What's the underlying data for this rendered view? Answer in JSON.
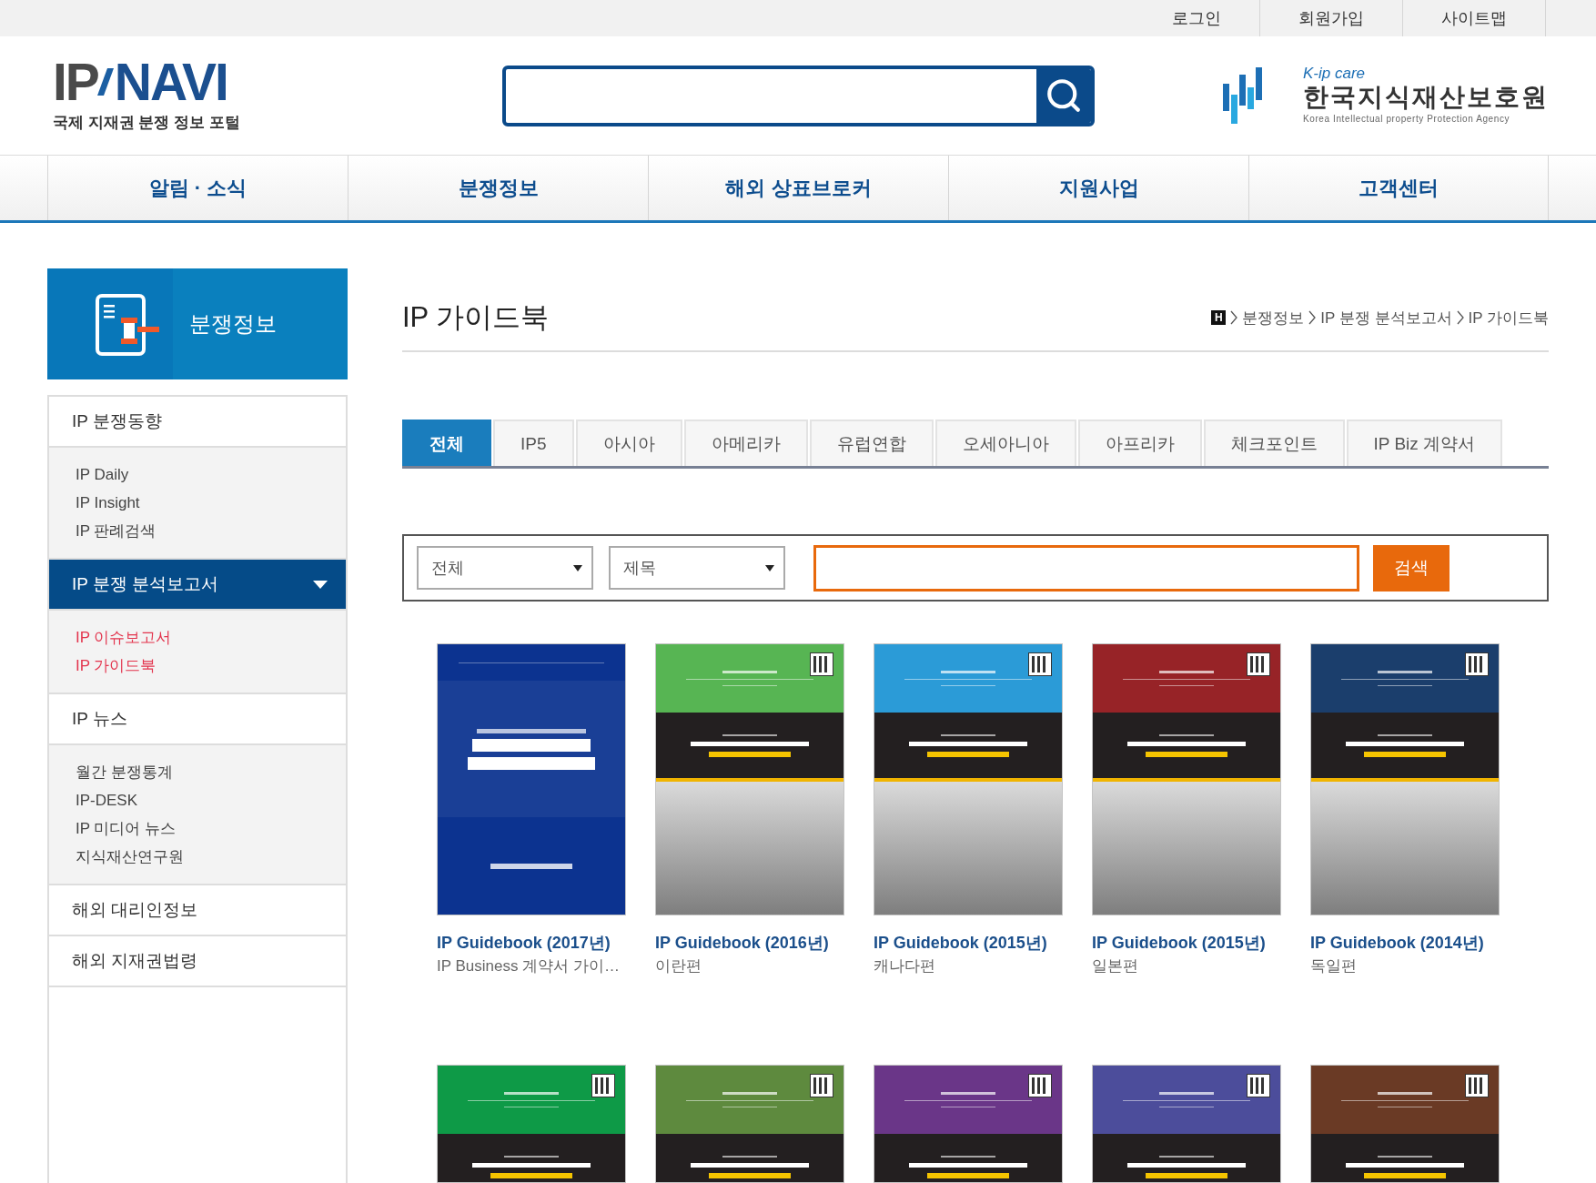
{
  "top_links": [
    "로그인",
    "회원가입",
    "사이트맵"
  ],
  "logo": {
    "left": "IP",
    "right": "NAVI",
    "tagline": "국제 지재권 분쟁 정보 포털"
  },
  "agency": {
    "brand": "K-ip care",
    "name": "한국지식재산보호원",
    "english": "Korea Intellectual property Protection Agency"
  },
  "nav": [
    "알림 · 소식",
    "분쟁정보",
    "해외 상표브로커",
    "지원사업",
    "고객센터"
  ],
  "sidebar": {
    "title": "분쟁정보",
    "sections": [
      {
        "label": "IP 분쟁동향",
        "selected": false,
        "children": [
          {
            "label": "IP Daily"
          },
          {
            "label": "IP Insight"
          },
          {
            "label": "IP 판례검색"
          }
        ]
      },
      {
        "label": "IP 분쟁 분석보고서",
        "selected": true,
        "children": [
          {
            "label": "IP 이슈보고서"
          },
          {
            "label": "IP 가이드북"
          }
        ]
      },
      {
        "label": "IP 뉴스",
        "selected": false,
        "children": [
          {
            "label": "월간 분쟁통계"
          },
          {
            "label": "IP-DESK"
          },
          {
            "label": "IP 미디어 뉴스"
          },
          {
            "label": "지식재산연구원"
          }
        ]
      },
      {
        "label": "해외 대리인정보",
        "selected": false
      },
      {
        "label": "해외 지재권법령",
        "selected": false
      }
    ]
  },
  "page": {
    "title": "IP 가이드북",
    "breadcrumb": {
      "home": "H",
      "items": [
        "분쟁정보",
        "IP 분쟁 분석보고서",
        "IP 가이드북"
      ]
    }
  },
  "tabs": [
    {
      "label": "전체",
      "selected": true
    },
    {
      "label": "IP5",
      "selected": false
    },
    {
      "label": "아시아",
      "selected": false
    },
    {
      "label": "아메리카",
      "selected": false
    },
    {
      "label": "유럽연합",
      "selected": false
    },
    {
      "label": "오세아니아",
      "selected": false
    },
    {
      "label": "아프리카",
      "selected": false
    },
    {
      "label": "체크포인트",
      "selected": false
    },
    {
      "label": "IP Biz 계약서",
      "selected": false
    }
  ],
  "filter": {
    "category": "전체",
    "field": "제목",
    "button": "검색"
  },
  "books": [
    {
      "kind": "plain",
      "color": "#0c3390",
      "title": "IP Guidebook (2017년)",
      "subtitle": "IP Business 계약서 가이…"
    },
    {
      "kind": "series",
      "color": "#57b553",
      "title": "IP Guidebook (2016년)",
      "subtitle": "이란편"
    },
    {
      "kind": "series",
      "color": "#2b9bd7",
      "title": "IP Guidebook (2015년)",
      "subtitle": "캐나다편"
    },
    {
      "kind": "series",
      "color": "#972327",
      "title": "IP Guidebook (2015년)",
      "subtitle": "일본편"
    },
    {
      "kind": "series",
      "color": "#1b3e6c",
      "title": "IP Guidebook (2014년)",
      "subtitle": "독일편"
    },
    {
      "kind": "series",
      "color": "#0e9a47"
    },
    {
      "kind": "series",
      "color": "#5e8a3e"
    },
    {
      "kind": "series",
      "color": "#6a3688"
    },
    {
      "kind": "series",
      "color": "#4c4d9b"
    },
    {
      "kind": "series",
      "color": "#6a3a25"
    }
  ]
}
